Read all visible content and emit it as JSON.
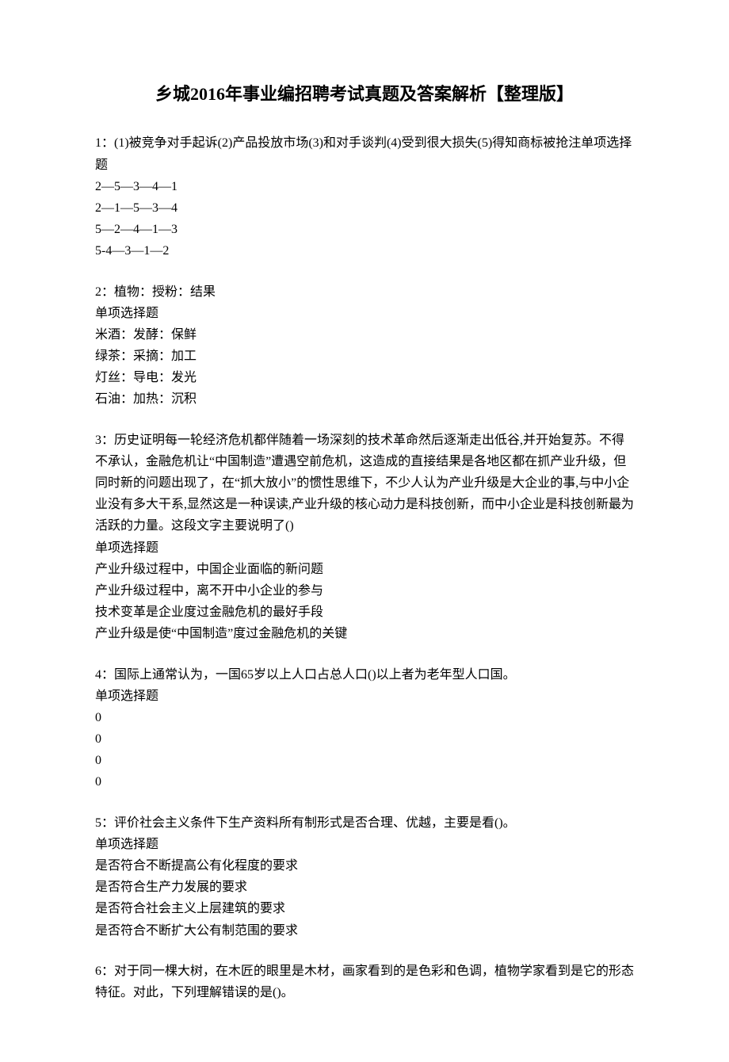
{
  "title": "乡城2016年事业编招聘考试真题及答案解析【整理版】",
  "questions": [
    {
      "stem": "1：(1)被竞争对手起诉(2)产品投放市场(3)和对手谈判(4)受到很大损失(5)得知商标被抢注单项选择题",
      "options": [
        "2—5—3—4—1",
        "2—1—5—3—4",
        "5—2—4—1—3",
        "5-4—3—1—2"
      ]
    },
    {
      "stem": "2：植物：授粉：结果",
      "type": "单项选择题",
      "options": [
        "米酒：发酵：保鲜",
        "绿茶：采摘：加工",
        "灯丝：导电：发光",
        "石油：加热：沉积"
      ]
    },
    {
      "stem": "3：历史证明每一轮经济危机都伴随着一场深刻的技术革命然后逐渐走出低谷,并开始复苏。不得不承认，金融危机让“中国制造”遭遇空前危机，这造成的直接结果是各地区都在抓产业升级，但同时新的问题出现了，在“抓大放小”的惯性思维下，不少人认为产业升级是大企业的事,与中小企业没有多大干系,显然这是一种误读,产业升级的核心动力是科技创新，而中小企业是科技创新最为活跃的力量。这段文字主要说明了()",
      "type": "单项选择题",
      "options": [
        "产业升级过程中，中国企业面临的新问题",
        "产业升级过程中，离不开中小企业的参与",
        "技术变革是企业度过金融危机的最好手段",
        "产业升级是使“中国制造”度过金融危机的关键"
      ]
    },
    {
      "stem": "4：国际上通常认为，一国65岁以上人口占总人口()以上者为老年型人口国。",
      "type": "单项选择题",
      "options": [
        "0",
        "0",
        "0",
        "0"
      ]
    },
    {
      "stem": "5：评价社会主义条件下生产资料所有制形式是否合理、优越，主要是看()。",
      "type": "单项选择题",
      "options": [
        "是否符合不断提高公有化程度的要求",
        "是否符合生产力发展的要求",
        "是否符合社会主义上层建筑的要求",
        "是否符合不断扩大公有制范围的要求"
      ]
    },
    {
      "stem": "6：对于同一棵大树，在木匠的眼里是木材，画家看到的是色彩和色调，植物学家看到是它的形态特征。对此，下列理解错误的是()。",
      "type": "",
      "options": []
    }
  ]
}
